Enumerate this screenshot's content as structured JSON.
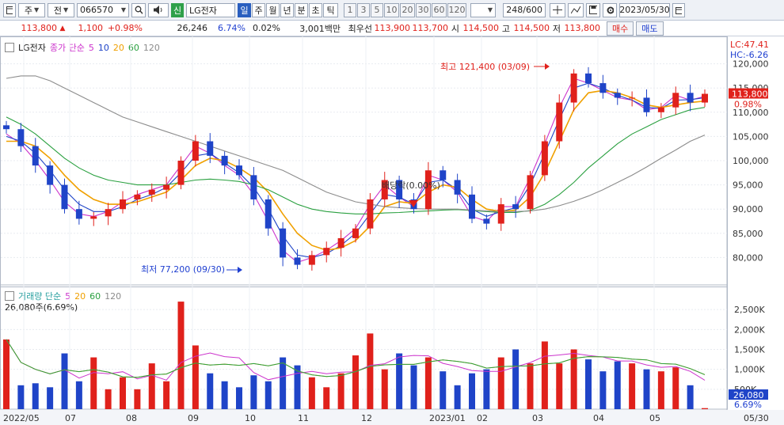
{
  "toolbar": {
    "period_select": "주",
    "mode_select": "전",
    "code": "066570",
    "market_badge": "신",
    "stock_name": "LG전자",
    "period_tabs": [
      "일",
      "주",
      "월",
      "년",
      "분",
      "초",
      "틱"
    ],
    "interval_tabs": [
      "1",
      "3",
      "5",
      "10",
      "20",
      "30",
      "60",
      "120"
    ],
    "count": "248/600",
    "date": "2023/05/30"
  },
  "quote": {
    "price": "113,800",
    "change": "1,100",
    "change_pct": "+0.98%",
    "volume": "26,246",
    "volume_ratio": "6.74%",
    "turnover_pct": "0.02%",
    "amount": "3,001백만",
    "best_sell_label": "최우선",
    "best_sell": "113,900",
    "best_buy": "113,700",
    "high_label": "시",
    "open": "114,500",
    "high_text_label": "고",
    "high": "114,500",
    "low_label": "저",
    "low": "113,800",
    "buy_button": "매수",
    "sell_button": "매도"
  },
  "price_legend": {
    "name": "LG전자",
    "type": "종가 단순",
    "periods": [
      "5",
      "10",
      "20",
      "60",
      "120"
    ]
  },
  "volume_legend": {
    "name": "거래량 단순",
    "periods": [
      "5",
      "20",
      "60",
      "120"
    ],
    "current": "26,080주(6.69%)"
  },
  "annotations": {
    "high": "최고 121,400 (03/09)",
    "low": "최저 77,200 (09/30)",
    "dividend": "배당락(0.00%)",
    "lc": "LC:47.41",
    "hc": "HC:-6.26",
    "price_tag": "113,800",
    "price_tag_pct": "0.98%",
    "vol_tag": "26,080",
    "vol_tag_pct": "6.69%"
  },
  "colors": {
    "up": "#e0211b",
    "down": "#1f44c8",
    "ma5": "#cc33cc",
    "ma10": "#1f44c8",
    "ma20": "#f0a000",
    "ma60": "#2aa040",
    "ma120": "#8c8c8c"
  },
  "chart_data": [
    {
      "type": "candlestick",
      "title": "LG전자",
      "ylim": [
        75000,
        125000
      ],
      "yticks": [
        "80,000",
        "85,000",
        "90,000",
        "95,000",
        "100,000",
        "105,000",
        "110,000",
        "115,000",
        "120,000"
      ],
      "x_labels": [
        "2022/05",
        "07",
        "08",
        "09",
        "10",
        "11",
        "12",
        "2023/01",
        "02",
        "03",
        "04",
        "05",
        "05/30"
      ],
      "series": [
        {
          "name": "종가",
          "values": [
            106500,
            103000,
            99000,
            95000,
            90000,
            88000,
            88500,
            90000,
            92000,
            93000,
            94000,
            95000,
            100000,
            104000,
            101000,
            99000,
            97000,
            92000,
            86000,
            80000,
            78500,
            80500,
            82000,
            84000,
            86000,
            92000,
            96000,
            92000,
            90000,
            98000,
            96000,
            93000,
            88000,
            87000,
            91000,
            90000,
            97000,
            104000,
            112000,
            118000,
            116000,
            114000,
            113000,
            113000,
            110000,
            111000,
            114000,
            112000,
            113800
          ]
        },
        {
          "name": "5",
          "values": [
            105500,
            103500,
            100000,
            96000,
            91500,
            89000,
            88500,
            89500,
            91500,
            93000,
            94000,
            95000,
            99000,
            103000,
            101500,
            99000,
            97000,
            93000,
            87500,
            81500,
            79000,
            80000,
            81500,
            83500,
            86000,
            91000,
            95000,
            92500,
            90500,
            97000,
            96000,
            93500,
            88500,
            87500,
            90500,
            90500,
            96500,
            103500,
            111000,
            117000,
            116000,
            114500,
            113000,
            112500,
            110500,
            111000,
            113500,
            112500,
            113300
          ]
        },
        {
          "name": "10",
          "values": [
            105000,
            104000,
            101500,
            98000,
            94000,
            91000,
            89500,
            89500,
            90500,
            92000,
            93000,
            94500,
            97500,
            101000,
            101500,
            99500,
            97500,
            94500,
            90000,
            84500,
            80500,
            80000,
            80800,
            82500,
            85000,
            89000,
            93000,
            92500,
            91000,
            95500,
            96000,
            94000,
            90000,
            88500,
            89500,
            90300,
            95000,
            101500,
            108500,
            115000,
            116000,
            115000,
            113500,
            112500,
            111000,
            110800,
            112500,
            112600,
            113000
          ]
        },
        {
          "name": "20",
          "values": [
            104000,
            104000,
            103000,
            100500,
            97000,
            94000,
            92000,
            91000,
            91000,
            91500,
            92500,
            93500,
            96000,
            99000,
            100500,
            100000,
            98500,
            96500,
            93500,
            89000,
            85000,
            82500,
            81500,
            82000,
            83500,
            86500,
            90500,
            91500,
            91200,
            93500,
            95000,
            94500,
            92000,
            90000,
            89500,
            89800,
            92500,
            97500,
            104000,
            110500,
            114000,
            114500,
            114000,
            113000,
            111500,
            111000,
            111500,
            112000,
            112300
          ]
        },
        {
          "name": "60",
          "values": [
            109000,
            107500,
            105500,
            103000,
            100500,
            98500,
            97000,
            96000,
            95500,
            95000,
            95000,
            95000,
            95500,
            96000,
            96200,
            96000,
            95700,
            95000,
            94000,
            92500,
            91000,
            90000,
            89500,
            89200,
            89000,
            89000,
            89200,
            89300,
            89500,
            89600,
            89800,
            89900,
            89700,
            89500,
            89300,
            89300,
            89700,
            91000,
            93000,
            95500,
            98500,
            101000,
            103500,
            105500,
            107000,
            108500,
            109500,
            110500,
            111000
          ]
        },
        {
          "name": "120",
          "values": [
            117000,
            117500,
            117500,
            116500,
            115000,
            113500,
            112000,
            110500,
            109000,
            108000,
            107000,
            106000,
            105000,
            104000,
            103000,
            102000,
            101000,
            100000,
            99000,
            98000,
            96500,
            95000,
            93500,
            92500,
            91500,
            91000,
            90500,
            90300,
            90100,
            90000,
            90000,
            90000,
            89800,
            89600,
            89500,
            89500,
            89600,
            90000,
            90700,
            91600,
            92700,
            94000,
            95500,
            97000,
            98700,
            100500,
            102200,
            104000,
            105300
          ]
        }
      ],
      "annotations": [
        "최고 121,400 (03/09)",
        "최저 77,200 (09/30)",
        "배당락(0.00%)"
      ]
    },
    {
      "type": "bar",
      "title": "거래량",
      "ylim": [
        0,
        3000000
      ],
      "yticks": [
        "500K",
        "1,000K",
        "1,500K",
        "2,000K",
        "2,500K"
      ],
      "values": [
        1750000,
        600000,
        650000,
        550000,
        1400000,
        700000,
        1300000,
        500000,
        800000,
        500000,
        1150000,
        700000,
        2700000,
        1600000,
        900000,
        700000,
        550000,
        850000,
        700000,
        1300000,
        1100000,
        800000,
        550000,
        900000,
        1350000,
        1900000,
        1000000,
        1400000,
        1100000,
        1300000,
        950000,
        600000,
        900000,
        1000000,
        1300000,
        1500000,
        1150000,
        1700000,
        1150000,
        1500000,
        1250000,
        950000,
        1200000,
        1150000,
        1000000,
        950000,
        1050000,
        600000,
        26080
      ]
    }
  ]
}
